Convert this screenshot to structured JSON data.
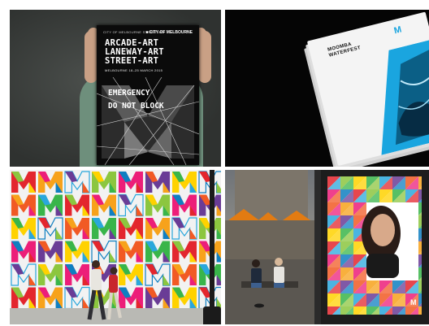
{
  "poster_1": {
    "eyebrow": "CITY OF MELBOURNE STREET ART",
    "logo": "■ CITY OF MELBOURNE",
    "headline_lines": [
      "ARCADE-ART",
      "LANEWAY-ART",
      "STREET-ART"
    ],
    "date": "MELBOURNE 18–25 MARCH 2015",
    "overlay_line_1": "EMERGENCY",
    "overlay_line_2": "DO NOT BLOCK"
  },
  "magazine": {
    "title_lines": [
      "MOOMBA",
      "WATERFEST"
    ],
    "logo": "M",
    "accent_color": "#1aa5df"
  },
  "wall_palette": [
    "#e3262e",
    "#f7a21b",
    "#2aa7dc",
    "#8cc63f",
    "#ec1e79",
    "#6a3c96",
    "#ffd200",
    "#0f7fc1",
    "#f15a24",
    "#39b54a"
  ],
  "poster_4": {
    "logo": "M"
  }
}
